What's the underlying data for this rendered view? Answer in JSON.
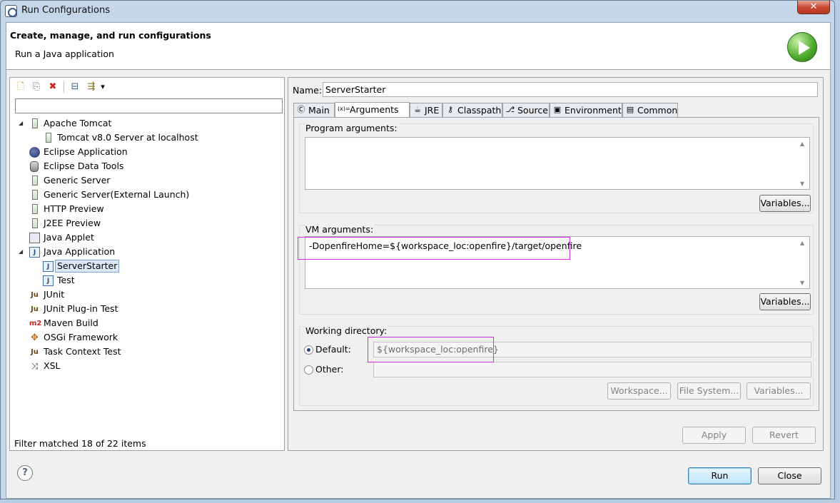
{
  "window": {
    "title": "Run Configurations",
    "close_glyph": "✕"
  },
  "banner": {
    "title": "Create, manage, and run configurations",
    "subtitle": "Run a Java application"
  },
  "toolbar": {
    "new": "🗋",
    "duplicate": "⎘",
    "delete": "✖",
    "collapse": "⊟",
    "filter": "⇶",
    "dropdown": "▾"
  },
  "filter": {
    "value": "",
    "status": "Filter matched 18 of 22 items"
  },
  "tree": [
    {
      "label": "Apache Tomcat",
      "depth": 0,
      "expanded": true,
      "icon": "server-icon"
    },
    {
      "label": "Tomcat v8.0 Server at localhost",
      "depth": 1,
      "icon": "server-icon"
    },
    {
      "label": "Eclipse Application",
      "depth": 0,
      "icon": "eclipse-icon"
    },
    {
      "label": "Eclipse Data Tools",
      "depth": 0,
      "icon": "database-icon"
    },
    {
      "label": "Generic Server",
      "depth": 0,
      "icon": "server-icon"
    },
    {
      "label": "Generic Server(External Launch)",
      "depth": 0,
      "icon": "server-icon"
    },
    {
      "label": "HTTP Preview",
      "depth": 0,
      "icon": "server-icon"
    },
    {
      "label": "J2EE Preview",
      "depth": 0,
      "icon": "server-icon"
    },
    {
      "label": "Java Applet",
      "depth": 0,
      "icon": "applet-icon"
    },
    {
      "label": "Java Application",
      "depth": 0,
      "expanded": true,
      "icon": "java-app-icon"
    },
    {
      "label": "ServerStarter",
      "depth": 1,
      "selected": true,
      "icon": "java-app-icon"
    },
    {
      "label": "Test",
      "depth": 1,
      "icon": "java-app-icon"
    },
    {
      "label": "JUnit",
      "depth": 0,
      "icon": "junit-icon"
    },
    {
      "label": "JUnit Plug-in Test",
      "depth": 0,
      "icon": "junit-plugin-icon"
    },
    {
      "label": "Maven Build",
      "depth": 0,
      "icon": "maven-icon"
    },
    {
      "label": "OSGi Framework",
      "depth": 0,
      "icon": "osgi-icon"
    },
    {
      "label": "Task Context Test",
      "depth": 0,
      "icon": "task-context-icon"
    },
    {
      "label": "XSL",
      "depth": 0,
      "icon": "xsl-icon"
    }
  ],
  "config": {
    "name_label": "Name:",
    "name_value": "ServerStarter",
    "tabs": [
      {
        "label": "Main",
        "icon": "main-tab-icon",
        "glyph": "Ⓒ"
      },
      {
        "label": "Arguments",
        "icon": "arguments-tab-icon",
        "glyph": "(x)=",
        "active": true
      },
      {
        "label": "JRE",
        "icon": "jre-tab-icon",
        "glyph": "☕"
      },
      {
        "label": "Classpath",
        "icon": "classpath-tab-icon",
        "glyph": "⚷"
      },
      {
        "label": "Source",
        "icon": "source-tab-icon",
        "glyph": "⎇"
      },
      {
        "label": "Environment",
        "icon": "environment-tab-icon",
        "glyph": "▣"
      },
      {
        "label": "Common",
        "icon": "common-tab-icon",
        "glyph": "▤"
      }
    ],
    "program_args": {
      "label": "Program arguments:",
      "value": "",
      "variables_button": "Variables..."
    },
    "vm_args": {
      "label": "VM arguments:",
      "value": "-DopenfireHome=${workspace_loc:openfire}/target/openfire",
      "variables_button": "Variables..."
    },
    "working_dir": {
      "label": "Working directory:",
      "default_label": "Default:",
      "default_value": "${workspace_loc:openfire}",
      "default_selected": true,
      "other_label": "Other:",
      "other_value": "",
      "workspace_button": "Workspace...",
      "filesystem_button": "File System...",
      "variables_button": "Variables..."
    },
    "apply_button": "Apply",
    "revert_button": "Revert"
  },
  "footer": {
    "help_glyph": "?",
    "run_button": "Run",
    "close_button": "Close"
  },
  "colors": {
    "highlight": "#d22ce6",
    "selection": "#dde8f7"
  }
}
